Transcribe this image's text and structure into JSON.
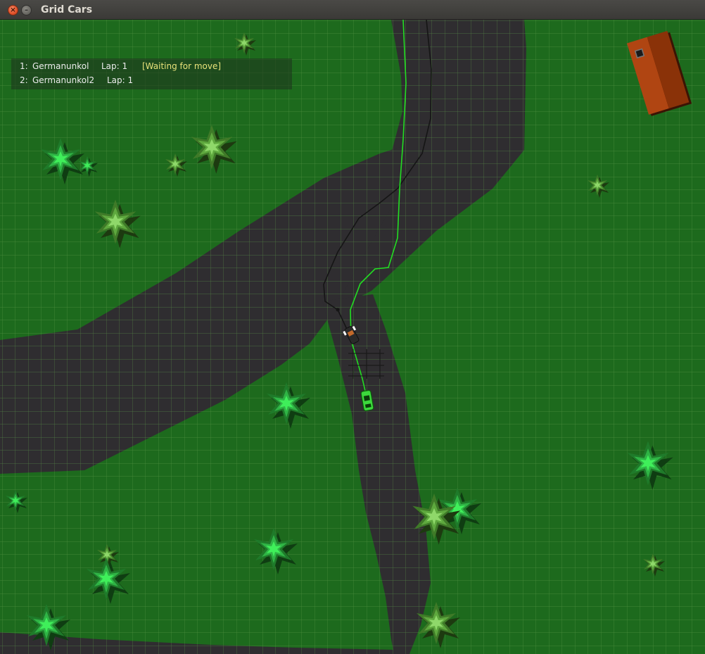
{
  "window": {
    "title": "Grid Cars",
    "close_glyph": "×",
    "minimize_glyph": "–"
  },
  "hud": {
    "players": [
      {
        "rank": "1:",
        "name": "Germanunkol",
        "lap": "Lap: 1",
        "status": "[Waiting for move]"
      },
      {
        "rank": "2:",
        "name": "Germanunkol2",
        "lap": "Lap: 1",
        "status": ""
      }
    ]
  },
  "colors": {
    "grass": "#1d6a1d",
    "road": "#2f2d30",
    "grid_line": "#5f9a49",
    "path_player1": "#22dd22",
    "path_player2": "#151515",
    "car_player1": "#3cd83c",
    "car_player2": "#2a2a2a",
    "house_roof": "#a33f0e",
    "hud_status": "#e8e27a"
  },
  "icons": {
    "close": "close-icon",
    "minimize": "minimize-icon",
    "tree": "tree-icon",
    "house": "house-icon",
    "car": "car-icon"
  }
}
